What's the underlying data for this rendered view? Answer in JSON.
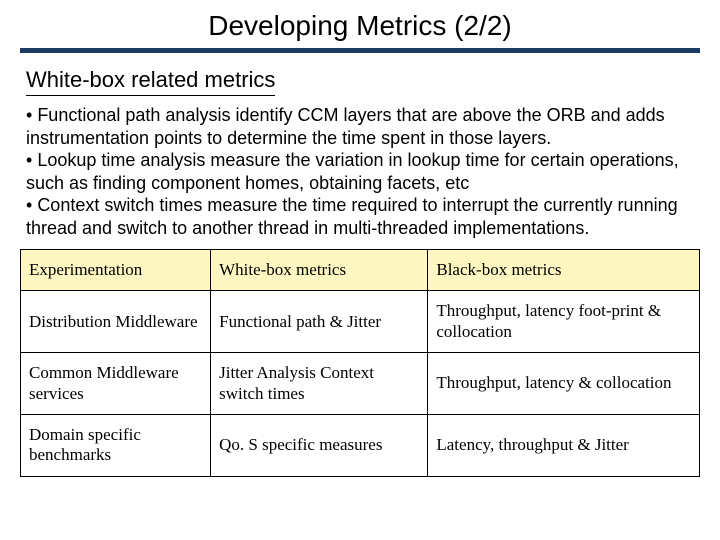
{
  "title": "Developing Metrics (2/2)",
  "subhead": "White-box related metrics",
  "bullets": {
    "b1_prefix": "• ",
    "b1_term": "Functional path",
    "b1_rest": " analysis identify CCM layers that are above the ORB and adds  instrumentation points to determine the time spent in those layers.",
    "b2_prefix": "• ",
    "b2_term": "Lookup time",
    "b2_rest": " analysis measure the variation in lookup time for certain operations, such as finding component homes, obtaining facets, etc",
    "b3_prefix": "• ",
    "b3_term": "Context switch",
    "b3_rest": " times  measure the time required to interrupt the currently running thread and switch to another thread in multi-threaded implementations."
  },
  "table": {
    "headers": {
      "c1": "Experimentation",
      "c2": "White-box metrics",
      "c3": "Black-box metrics"
    },
    "rows": [
      {
        "c1": "Distribution Middleware",
        "c2": "Functional path & Jitter",
        "c3": "Throughput, latency foot-print & collocation"
      },
      {
        "c1": "Common Middleware services",
        "c2": "Jitter Analysis Context switch times",
        "c3": "Throughput, latency & collocation"
      },
      {
        "c1": "Domain specific benchmarks",
        "c2": "Qo. S specific measures",
        "c3": "Latency, throughput & Jitter"
      }
    ]
  }
}
